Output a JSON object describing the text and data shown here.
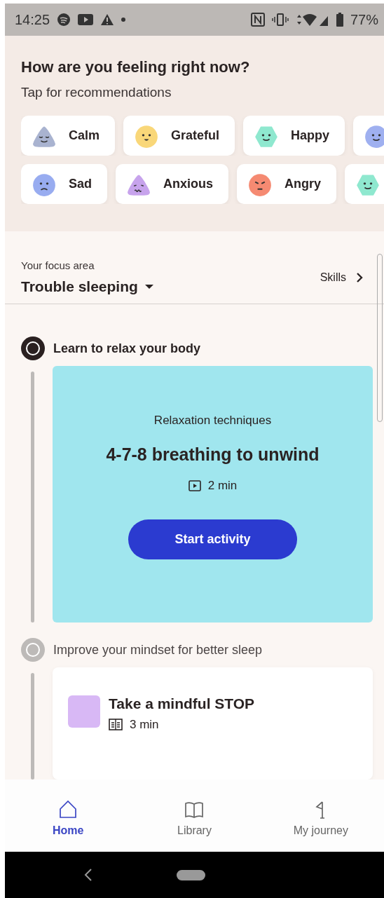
{
  "status_bar": {
    "time": "14:25",
    "battery": "77%"
  },
  "mood_prompt": {
    "title": "How are you feeling right now?",
    "subtitle": "Tap for recommendations"
  },
  "mood_rows": [
    [
      {
        "label": "Calm",
        "kind": "calm",
        "color": "#a9b3d0"
      },
      {
        "label": "Grateful",
        "kind": "grateful",
        "color": "#f9d779"
      },
      {
        "label": "Happy",
        "kind": "happy",
        "color": "#8fe8cf"
      },
      {
        "kind": "cheerful",
        "color": "#9fb0f0"
      }
    ],
    [
      {
        "label": "Sad",
        "kind": "sad",
        "color": "#98acf0"
      },
      {
        "label": "Anxious",
        "kind": "anxious",
        "color": "#c7a3ec"
      },
      {
        "label": "Angry",
        "kind": "angry",
        "color": "#f58a72"
      },
      {
        "kind": "relieved",
        "color": "#8fe8cf"
      }
    ]
  ],
  "focus": {
    "caption": "Your focus area",
    "value": "Trouble sleeping",
    "link": "Skills"
  },
  "steps": [
    {
      "title": "Learn to relax your body",
      "active": true,
      "card": {
        "kind": "featured",
        "category": "Relaxation techniques",
        "title": "4-7-8 breathing to unwind",
        "duration": {
          "kind": "video",
          "text": "2 min"
        },
        "button": "Start activity"
      }
    },
    {
      "title": "Improve your mindset for better sleep",
      "active": false,
      "card": {
        "kind": "compact",
        "title": "Take a mindful STOP",
        "duration": {
          "kind": "reading",
          "text": "3 min"
        },
        "color": "#d8b8f5"
      }
    }
  ],
  "bottom_nav": [
    {
      "label": "Home",
      "selected": true
    },
    {
      "label": "Library",
      "selected": false
    },
    {
      "label": "My journey",
      "selected": false
    }
  ]
}
